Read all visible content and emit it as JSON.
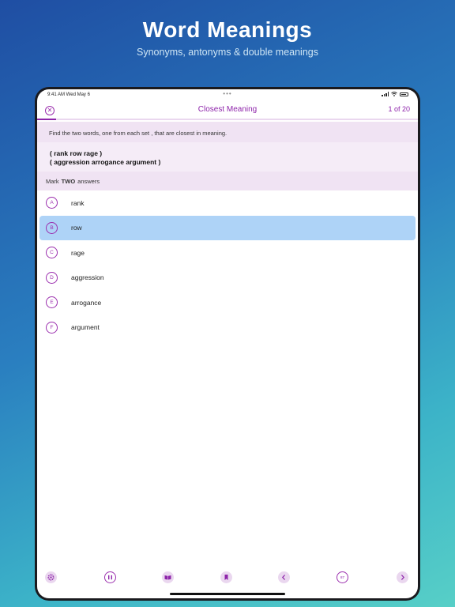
{
  "hero": {
    "title": "Word Meanings",
    "subtitle": "Synonyms, antonyms & double meanings"
  },
  "status_bar": {
    "time": "9:41 AM  Wed May 6",
    "dots": "•••"
  },
  "nav": {
    "close_glyph": "✕",
    "title": "Closest Meaning",
    "counter": "1 of 20",
    "progress": 0.05
  },
  "instruction": "Find the two words, one from each set , that are closest in meaning.",
  "question": {
    "line1": "( rank row rage )",
    "line2": "( aggression arrogance argument )"
  },
  "mark": {
    "prefix": "Mark",
    "count": "TWO",
    "suffix": "answers"
  },
  "options": [
    {
      "letter": "A",
      "text": "rank",
      "selected": false
    },
    {
      "letter": "B",
      "text": "row",
      "selected": true
    },
    {
      "letter": "C",
      "text": "rage",
      "selected": false
    },
    {
      "letter": "D",
      "text": "aggression",
      "selected": false
    },
    {
      "letter": "E",
      "text": "arrogance",
      "selected": false
    },
    {
      "letter": "F",
      "text": "argument",
      "selected": false
    }
  ],
  "toolbar": {
    "settings_icon": "gear-icon",
    "pause_icon": "pause-icon",
    "book_icon": "book-icon",
    "bookmark_icon": "bookmark-icon",
    "prev_icon": "chevron-left-icon",
    "jump_label": "87",
    "next_icon": "chevron-right-icon"
  },
  "colors": {
    "accent": "#8e24aa",
    "selected_row": "#aed3f7",
    "banner": "#f0e3f3"
  }
}
